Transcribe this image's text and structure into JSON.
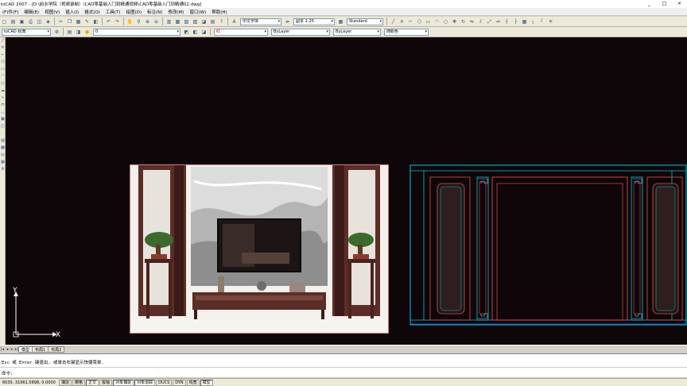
{
  "window": {
    "title": "toCAD 2007 - [D:\\前水学院（视频录制）\\CAD零基础入门到精通视频\\CAD零基础入门到精通02.dwg]",
    "min": "_",
    "max": "□",
    "close": "×"
  },
  "menu": [
    "(F)件(F)",
    "编辑(E)",
    "视图(V)",
    "插入(I)",
    "格式(O)",
    "工具(T)",
    "绘图(D)",
    "标注(N)",
    "修改(M)",
    "窗口(W)",
    "帮助(H)"
  ],
  "toolbar1": {
    "text_style": "中文字体",
    "dim_style": "副本 1-25",
    "table_style": "Standard"
  },
  "toolbar2": {
    "workspace": "toCAD 经典",
    "layer": "0",
    "color": "红",
    "linetype": "ByLayer",
    "lineweight": "ByLayer",
    "plotstyle": "随颜色"
  },
  "ucs": {
    "x_label": "X",
    "y_label": "Y"
  },
  "tabs": [
    "模型",
    "布局1",
    "布局2"
  ],
  "command": {
    "history": "Esc 或 Enter 键退出, 或单击右键显示快捷菜单.",
    "prompt": "命令:"
  },
  "status": {
    "coords": "6035, 31961.5898, 0.0000",
    "buttons": [
      {
        "label": "捕捉",
        "on": false
      },
      {
        "label": "栅格",
        "on": false
      },
      {
        "label": "正交",
        "on": true
      },
      {
        "label": "极轴",
        "on": false
      },
      {
        "label": "对象捕捉",
        "on": true
      },
      {
        "label": "对象追踪",
        "on": true
      },
      {
        "label": "DUCS",
        "on": false
      },
      {
        "label": "DYN",
        "on": false
      },
      {
        "label": "线宽",
        "on": false
      },
      {
        "label": "模型",
        "on": true
      }
    ]
  },
  "photo_inset": {
    "label": "内容屏幕"
  },
  "colors": {
    "canvas": "#0e0608",
    "cad_cyan": "#00c8d8",
    "cad_red": "#e05050",
    "cad_blue": "#3050ff"
  }
}
